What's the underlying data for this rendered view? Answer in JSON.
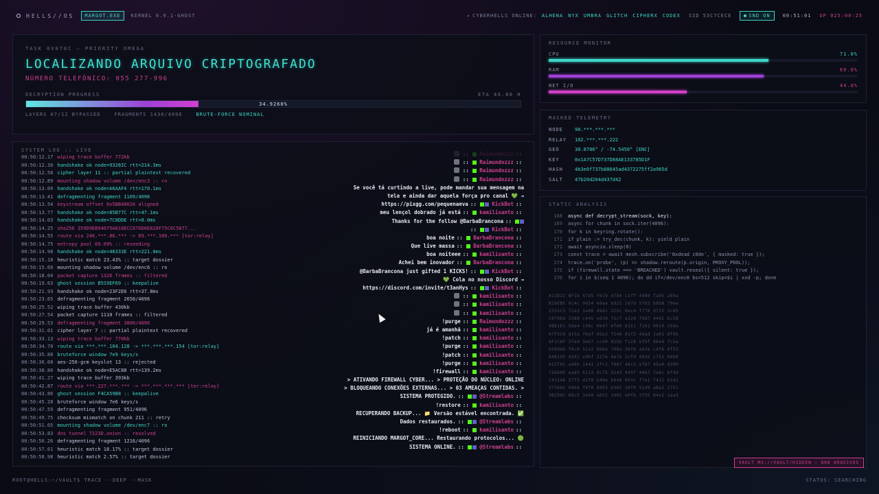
{
  "topbar": {
    "brand": "HELLS//OS",
    "tag": "MARGOT.EXE",
    "kernel": "KERNEL 6.9.1-GHOST",
    "online_label": "CYBERHELLS ONLINE:",
    "users": [
      "ALHENA",
      "NYX",
      "UMBRA",
      "GLITCH",
      "CIPHERX",
      "CODEX"
    ],
    "sid": "SID 53C7CECE",
    "snd": "SND ON",
    "clock": "00:51:01",
    "uptime": "UP 025:00:25"
  },
  "task": {
    "id": "TASK 0X070C — PRIORITY OMEGA",
    "title": "LOCALIZANDO ARQUIVO CRIPTOGRAFADO",
    "phone": "NÚMERO TELEFÔNICO: 055 277-996",
    "progress_label": "DECRYPTION PROGRESS",
    "eta": "ETA 46.86 H",
    "progress_pct": 34.926,
    "progress_text": "34.9260%",
    "layers": "LAYERS 07/12 BYPASSED",
    "fragments": "FRAGMENTS 1430/4096",
    "mode": "BRUTE-FORCE NOMINAL"
  },
  "log": {
    "title": "SYSTEM LOG :: LIVE",
    "lines": [
      {
        "ts": "00:50:12.17",
        "msg": "wiping trace buffer 772kb",
        "c": "pink"
      },
      {
        "ts": "00:50:12.30",
        "msg": "handshake ok node=9328IC rtt=214.3ms",
        "c": "cyan"
      },
      {
        "ts": "00:50:12.58",
        "msg": "cipher layer 11 :: partial plaintext recovered",
        "c": "cyan"
      },
      {
        "ts": "00:50:12.89",
        "msg": "mounting shadow volume /dev/enc3 :: ro",
        "c": "pink"
      },
      {
        "ts": "00:50:13.09",
        "msg": "handshake ok node=A6AAF4 rtt=170.1ms",
        "c": "cyan"
      },
      {
        "ts": "00:50:13.41",
        "msg": "defragmenting fragment 1109/4096",
        "c": "cyan"
      },
      {
        "ts": "00:50:13.54",
        "msg": "keystream offset 0x5BB40026 aligned",
        "c": "pink"
      },
      {
        "ts": "00:50:13.77",
        "msg": "handshake ok node=85B77C rtt=47.1ms",
        "c": "cyan"
      },
      {
        "ts": "00:50:14.03",
        "msg": "handshake ok node=7C8DDE rtt=8.0ms",
        "c": "cyan"
      },
      {
        "ts": "00:50:14.25",
        "msg": "sha256 359D9EB94075A018ECC076D0E828F75C6C5877...",
        "c": "pink"
      },
      {
        "ts": "00:50:14.55",
        "msg": "route via 246.***.86.*** -> 69.***.160.*** [tor:relay]",
        "c": "pink"
      },
      {
        "ts": "00:50:14.75",
        "msg": "entropy pool 69.09% :: reseeding",
        "c": "pink"
      },
      {
        "ts": "00:50:14.98",
        "msg": "handshake ok node=48333E rtt=221.0ms",
        "c": "cyan"
      },
      {
        "ts": "00:50:15.18",
        "msg": "heuristic match 23.43% :: target dossier",
        "c": "normal"
      },
      {
        "ts": "00:50:15.60",
        "msg": "mounting shadow volume /dev/enc6 :: ro",
        "c": "normal"
      },
      {
        "ts": "00:50:18.04",
        "msg": "packet capture 1326 frames :: filtered",
        "c": "pink"
      },
      {
        "ts": "00:50:19.63",
        "msg": "ghost session B5S9EF69 :: keepalive",
        "c": "cyan"
      },
      {
        "ts": "00:50:21.93",
        "msg": "handshake ok node=23F2E6 rtt=37.8ms",
        "c": "normal"
      },
      {
        "ts": "00:50:23.65",
        "msg": "defragmenting fragment 2650/4096",
        "c": "normal"
      },
      {
        "ts": "00:50:25.52",
        "msg": "wiping trace buffer 430kb",
        "c": "normal"
      },
      {
        "ts": "00:50:27.54",
        "msg": "packet capture 1110 frames :: filtered",
        "c": "normal"
      },
      {
        "ts": "00:50:29.53",
        "msg": "defragmenting fragment 3800/4096",
        "c": "pink"
      },
      {
        "ts": "00:50:31.01",
        "msg": "cipher layer 7 :: partial plaintext recovered",
        "c": "normal"
      },
      {
        "ts": "00:50:33.13",
        "msg": "wiping trace buffer 770kb",
        "c": "pink"
      },
      {
        "ts": "00:50:34.70",
        "msg": "route via ***.***.104.128 -> ***.***.***.154 [tor:relay]",
        "c": "cyan"
      },
      {
        "ts": "00:50:35.88",
        "msg": "bruteforce window 7e9 keys/s",
        "c": "cyan"
      },
      {
        "ts": "00:50:36.68",
        "msg": "aes-256-gcm keyslot 13 :: rejected",
        "c": "normal"
      },
      {
        "ts": "00:50:38.80",
        "msg": "handshake ok node=E5AC88 rtt=139.2ms",
        "c": "normal"
      },
      {
        "ts": "00:50:41.27",
        "msg": "wiping trace buffer 393kb",
        "c": "normal"
      },
      {
        "ts": "00:50:42.87",
        "msg": "route via ***.227.***.*** -> ***.***.***.*** [tor:relay]",
        "c": "pink"
      },
      {
        "ts": "00:50:43.86",
        "msg": "ghost session F4CA59B8 :: keepalive",
        "c": "cyan"
      },
      {
        "ts": "00:50:45.28",
        "msg": "bruteforce window 7e6 keys/s",
        "c": "normal"
      },
      {
        "ts": "00:50:47.59",
        "msg": "defragmenting fragment 951/4096",
        "c": "normal"
      },
      {
        "ts": "00:50:49.75",
        "msg": "checksum mismatch on chunk 211 :: retry",
        "c": "normal"
      },
      {
        "ts": "00:50:51.65",
        "msg": "mounting shadow volume /dev/enc7 :: ro",
        "c": "cyan"
      },
      {
        "ts": "00:50:53.83",
        "msg": "dns tunnel 7223D.onion :: resolved",
        "c": "pink"
      },
      {
        "ts": "00:50:56.26",
        "msg": "defragmenting fragment 1216/4096",
        "c": "normal"
      },
      {
        "ts": "00:50:57.61",
        "msg": "heuristic match 18.17% :: target dossier",
        "c": "normal"
      },
      {
        "ts": "00:50:58.98",
        "msg": "heuristic match 2.57% :: target dossier",
        "c": "normal"
      }
    ]
  },
  "chat": [
    {
      "text": "",
      "user": "Raimundozzz",
      "avatar": true,
      "dim": true
    },
    {
      "text": "",
      "user": "Raimundozzz",
      "avatar": true
    },
    {
      "text": "",
      "user": "Raimundozzz",
      "avatar": true
    },
    {
      "text": "",
      "user": "Raimundozzz",
      "avatar": true
    },
    {
      "text": "Se você tá curtindo a live, pode mandar sua mensagem na",
      "user": "",
      "plain": true
    },
    {
      "text": "tela e ainda dar aquela força pro canal 💚 →",
      "user": "",
      "plain": true
    },
    {
      "text": "https://pixgg.com/pequenaeva",
      "user": "KickBot"
    },
    {
      "text": "meu lençol dobrado já está",
      "user": "kamilisanto"
    },
    {
      "text": "Thanks for the follow @BarbaBrancona",
      "user": "",
      "botend": true
    },
    {
      "text": "",
      "user": "KickBot",
      "only": true
    },
    {
      "text": "boa noite",
      "user": "BarbaBrancona"
    },
    {
      "text": "Que live massa",
      "user": "BarbaBrancona"
    },
    {
      "text": "boa noiteee",
      "user": "kamilisanto"
    },
    {
      "text": "Achei bem inovador",
      "user": "BarbaBrancona"
    },
    {
      "text": "@BarbaBrancona just gifted 1 KICKS!",
      "user": "KickBot"
    },
    {
      "text": "💚 Cola no nosso Discord →",
      "user": "",
      "plain": true
    },
    {
      "text": "https://discord.com/invite/t3anHys",
      "user": "KickBot"
    },
    {
      "text": "",
      "user": "kamilisanto",
      "avatar": true
    },
    {
      "text": "",
      "user": "kamilisanto",
      "avatar": true
    },
    {
      "text": "",
      "user": "kamilisanto",
      "avatar": true
    },
    {
      "text": "!purge",
      "user": "Raimundozzz"
    },
    {
      "text": "já é amanhã",
      "user": "kamilisanto"
    },
    {
      "text": "!patch",
      "user": "kamilisanto"
    },
    {
      "text": "!purge",
      "user": "kamilisanto"
    },
    {
      "text": "!patch",
      "user": "kamilisanto"
    },
    {
      "text": "!purge",
      "user": "kamilisanto"
    },
    {
      "text": "!firewall",
      "user": "kamilisanto"
    },
    {
      "text": "> ATIVANDO FIREWALL CYBER... > PROTEÇÃO DO NÚCLEO: ONLINE",
      "user": "",
      "plain": true
    },
    {
      "text": "> BLOQUEANDO CONEXÕES EXTERNAS... > 03 AMEAÇAS CONTIDAS. >",
      "user": "",
      "plain": true
    },
    {
      "text": "SISTEMA PROTEGIDO.",
      "user": "@Streamlabs"
    },
    {
      "text": "!restore",
      "user": "kamilisanto"
    },
    {
      "text": "RECUPERANDO BACKUP... 📁 Versão estável encontrada. ✅",
      "user": "",
      "plain": true
    },
    {
      "text": "Dados restaurados.",
      "user": "@Streamlabs"
    },
    {
      "text": "!reboot",
      "user": "kamilisanto"
    },
    {
      "text": "REINICIANDO MARGOT_CORE... Restaurando protocolos... 🟢",
      "user": "",
      "plain": true
    },
    {
      "text": "SISTEMA ONLINE.",
      "user": "@Streamlabs"
    }
  ],
  "resources": {
    "title": "RESOURCE MONITOR",
    "rows": [
      {
        "label": "CPU",
        "pct": 71.0,
        "text": "71.0%",
        "color": "#3fd6c8"
      },
      {
        "label": "RAM",
        "pct": 69.6,
        "text": "69.6%",
        "color": "#a040d8"
      },
      {
        "label": "NET I/O",
        "pct": 44.6,
        "text": "44.6%",
        "color": "#d040c8"
      }
    ]
  },
  "telemetry": {
    "title": "MASKED TELEMETRY",
    "rows": [
      {
        "k": "NODE",
        "v": "90.***.***.***"
      },
      {
        "k": "RELAY",
        "v": "102.***.***.222"
      },
      {
        "k": "GEO",
        "v": "30.8706° / -74.5450° [ENC]"
      },
      {
        "k": "KEY",
        "v": "0x1A7C57D737D88AE133785D1F"
      },
      {
        "k": "HASH",
        "v": "4b3e0f737b88645ad4372275ff2a965d"
      },
      {
        "k": "SALT",
        "v": "47b20d204d437d42"
      }
    ]
  },
  "analysis": {
    "title": "STATIC ANALYSIS",
    "code": [
      {
        "n": "168",
        "t": "async def decrypt_stream(sock, key):",
        "hl": true
      },
      {
        "n": "169",
        "t": "async for chunk in sock.iter(4096):"
      },
      {
        "n": "170",
        "t": "for k in keyring.rotate():"
      },
      {
        "n": "171",
        "t": "if plain := try_dec(chunk, k): yield plain"
      },
      {
        "n": "172",
        "t": "await asyncio.sleep(0)"
      },
      {
        "n": "173",
        "t": "const trace = await mesh.subscribe('0xdead c0de', { masked: true });"
      },
      {
        "n": "174",
        "t": "trace.on('probe', (p) => shadow.reroute(p.origin, PROXY_POOL));"
      },
      {
        "n": "175",
        "t": "if (firewall.state === 'BREACHED') vault.reseal({ silent: true });"
      },
      {
        "n": "176",
        "t": "for i in $(seq 1 4096); do dd if=/dev/enc0 bs=512 skip=$i | xxd -p; done"
      }
    ],
    "hex": [
      "A13D22 8F1b 47d5 f619 d784 c1ff 4d90 fa05 285e",
      "B28EB5 0c4c 9d14 e9ae bd25 167d 5f83 b8b8 79ee",
      "3355C5 71e3 1e06 49dc 325c 9ec4 f770 d715 3c85",
      "C070EA 3388 c445 ed30 f1c7 a228 79d7 4402 bc58",
      "4BB1E1 5da4 c04c 0b47 6f60 8151 f1b2 0010 29de",
      "07F5C8 d15a f6af 95e3 f548 01f2 4dad 1a01 8f0b",
      "9F1CAF 37ed 3eb7 ccd0 825b f128 ef9f 86e9 7c5a",
      "9589AD f0c0 51a3 8bbe 790a 30f8 a92e c4f6 0f53",
      "8AB103 4201 e9bf 227e 6e7b 2cfd 90d2 c752 68b0",
      "A1CF81 ad6b 1441 2fc1 f887 48c3 e767 49a4 d390",
      "75D60E ea85 6123 0c75 d143 949f 4067 7ebc bfdd",
      "C4314A 57f5 d2f0 b49e b648 003c f7e1 7411 b1d1",
      "273682 09b8 f4f0 9455 b365 36f0 51d9 a8a1 2751",
      "3B2D8C 68c5 3e49 a652 1465 e0fb 3f55 94e2 1ea3"
    ]
  },
  "vault": "VAULT MS://VAULT/HIDDEN — 888 ARQUIVOS",
  "footer": {
    "prompt": "ROOT@HELLS:~/VAULT$ TRACE --DEEP --MASK",
    "status": "STATUS: SEARCHING"
  }
}
